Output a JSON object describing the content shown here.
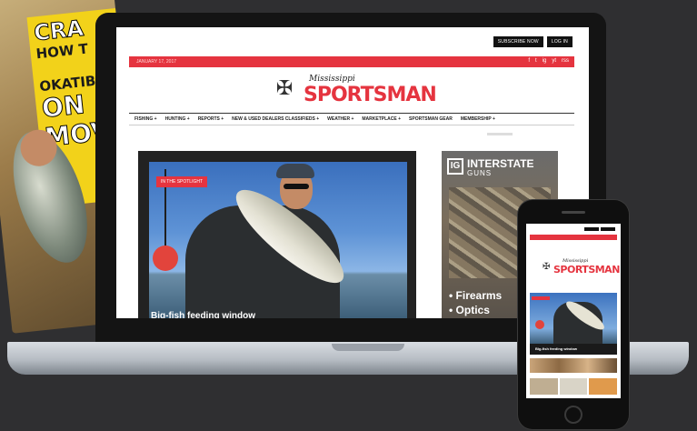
{
  "magazine": {
    "headline_1": "CRA",
    "headline_2": "HOW T",
    "headline_3": "OKATIB",
    "headline_4": "ON",
    "headline_5": "MOV"
  },
  "site": {
    "top_buttons": [
      "SUBSCRIBE NOW",
      "LOG IN"
    ],
    "date": "JANUARY 17, 2017",
    "social_icons": [
      "f",
      "t",
      "ig",
      "yt",
      "rss"
    ],
    "logo_small": "Mississippi",
    "logo_big": "SPORTSMAN",
    "nav": [
      "FISHING +",
      "HUNTING +",
      "REPORTS +",
      "NEW & USED DEALERS CLASSIFIEDS +",
      "WEATHER +",
      "MARKETPLACE +",
      "SPORTSMAN GEAR",
      "MEMBERSHIP +"
    ],
    "hero_tag": "IN THE SPOTLIGHT",
    "hero_caption": "Big-fish feeding window",
    "ad": {
      "brand_top": "INTERSTATE",
      "brand_bottom": "GUNS",
      "line_1": "• Firearms",
      "line_2": "• Optics"
    }
  },
  "phone": {
    "logo_small": "Mississippi",
    "logo_big": "SPORTSMAN",
    "caption": "Big-fish feeding window"
  },
  "colors": {
    "brand_red": "#e5343f",
    "background": "#2f2f31"
  }
}
